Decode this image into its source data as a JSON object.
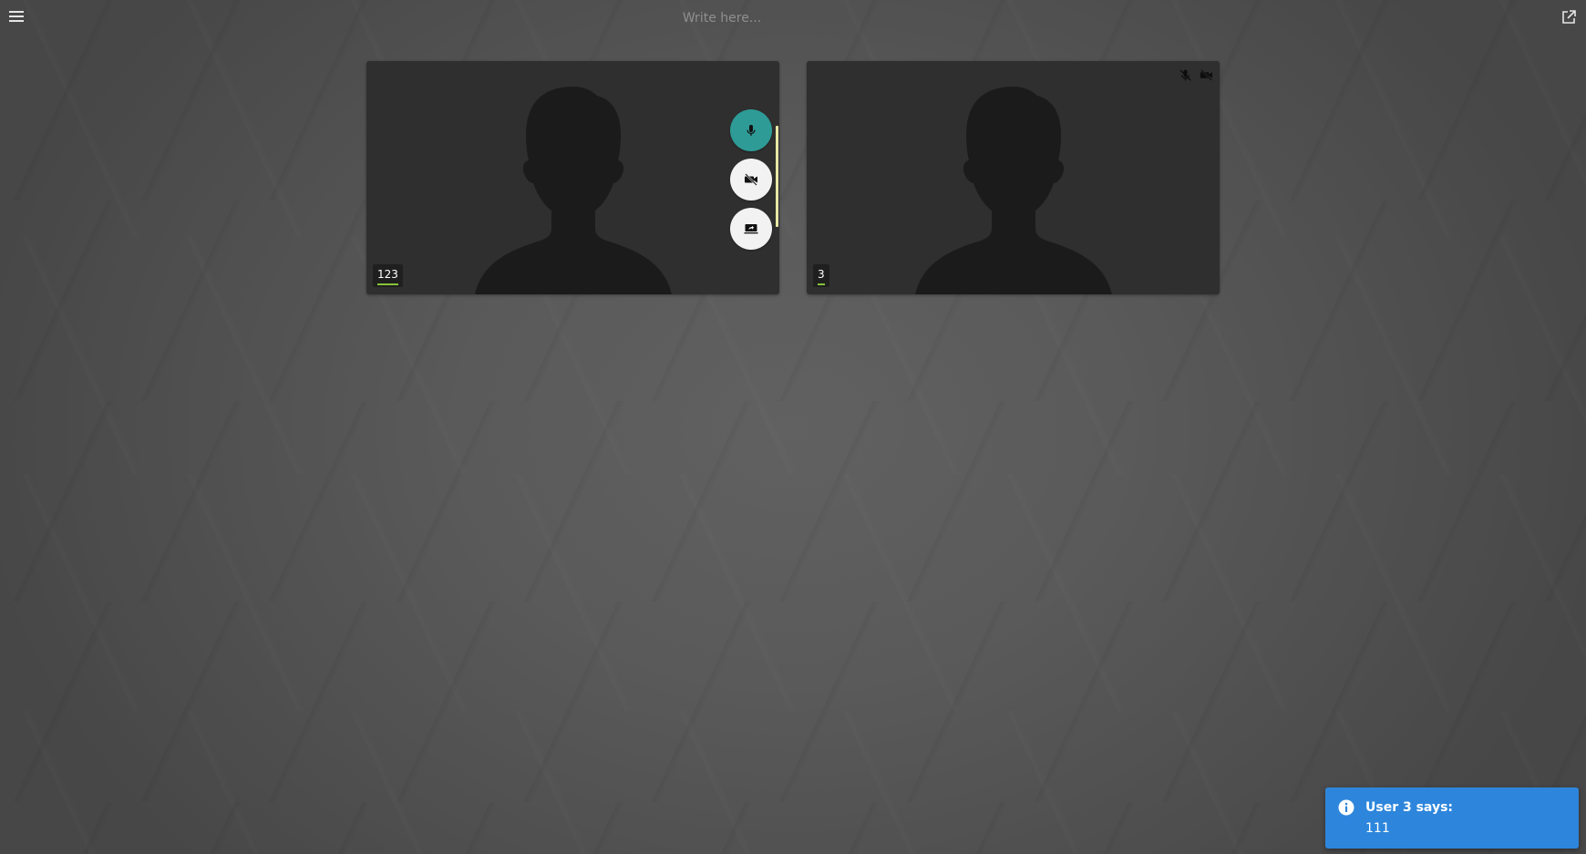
{
  "toolbar": {
    "menu_icon": "hamburger-menu-icon",
    "topic_placeholder": "Write here...",
    "popout_icon": "external-link-icon"
  },
  "local_tile": {
    "name": "123",
    "controls": [
      {
        "icon": "microphone-icon",
        "state": "on"
      },
      {
        "icon": "camera-off-icon",
        "state": "off"
      },
      {
        "icon": "screen-share-icon",
        "state": "off"
      }
    ],
    "audio_level": 0.85
  },
  "remote_tile": {
    "name": "3",
    "status_icons": [
      "microphone-muted-icon",
      "camera-off-icon"
    ]
  },
  "notification": {
    "icon": "info-icon",
    "title": "User 3 says:",
    "message": "111"
  },
  "colors": {
    "mic_active": "#2e9b96",
    "audio_indicator": "#86c23a",
    "notification_bg": "#2d86dc"
  }
}
